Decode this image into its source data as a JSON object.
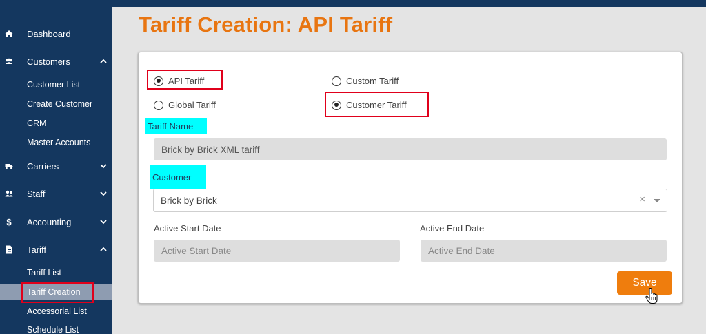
{
  "sidebar": {
    "items": [
      {
        "label": "Dashboard",
        "icon": "home-icon"
      },
      {
        "label": "Customers",
        "icon": "users-icon",
        "expanded": true,
        "children": [
          "Customer List",
          "Create Customer",
          "CRM",
          "Master Accounts"
        ]
      },
      {
        "label": "Carriers",
        "icon": "truck-icon",
        "expanded": false
      },
      {
        "label": "Staff",
        "icon": "staff-icon",
        "expanded": false
      },
      {
        "label": "Accounting",
        "icon": "dollar-icon",
        "expanded": false
      },
      {
        "label": "Tariff",
        "icon": "document-icon",
        "expanded": true,
        "children": [
          "Tariff List",
          "Tariff Creation",
          "Accessorial List",
          "Schedule List"
        ]
      }
    ],
    "active_item": "Tariff Creation"
  },
  "page": {
    "title": "Tariff Creation: API Tariff"
  },
  "form": {
    "radios": {
      "api_tariff": {
        "label": "API Tariff",
        "checked": true
      },
      "custom_tariff": {
        "label": "Custom Tariff",
        "checked": false
      },
      "global_tariff": {
        "label": "Global Tariff",
        "checked": false
      },
      "customer_tariff": {
        "label": "Customer Tariff",
        "checked": true
      }
    },
    "tariff_name": {
      "label": "Tariff Name",
      "value": "Brick by Brick XML tariff"
    },
    "customer": {
      "label": "Customer",
      "value": "Brick by Brick",
      "clear_symbol": "×"
    },
    "active_start": {
      "label": "Active Start Date",
      "placeholder": "Active Start Date"
    },
    "active_end": {
      "label": "Active End Date",
      "placeholder": "Active End Date"
    },
    "save_label": "Save"
  },
  "colors": {
    "sidebar_bg": "#14375f",
    "accent_orange": "#ef7d0d",
    "title_orange": "#e87511",
    "highlight_cyan": "#00ffff",
    "annotation_red": "#e0001b",
    "active_item_bg": "#8e9cb1"
  }
}
